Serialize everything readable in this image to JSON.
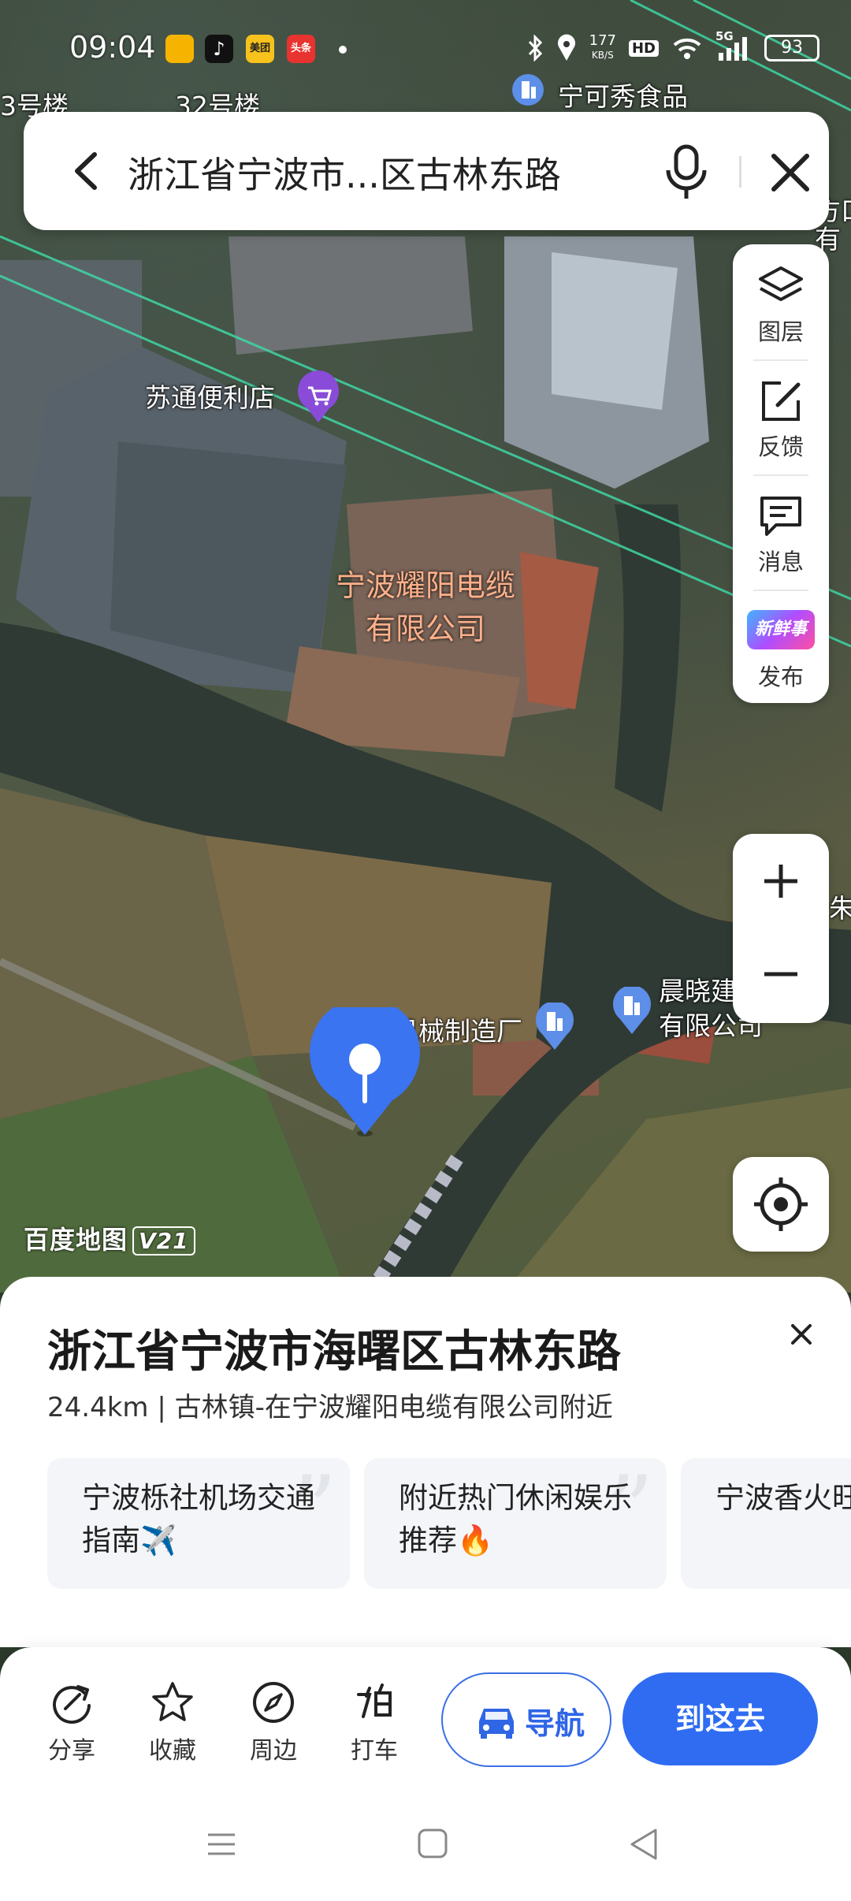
{
  "status_bar": {
    "time": "09:04",
    "net_speed_value": "177",
    "net_speed_unit": "KB/S",
    "hd_label": "HD",
    "network_label": "5G",
    "battery": "93",
    "app_icons": [
      {
        "name": "reader-app-icon",
        "text": "",
        "color": "#f6b400"
      },
      {
        "name": "douyin-app-icon",
        "text": "♪",
        "color": "#111111"
      },
      {
        "name": "meituan-app-icon",
        "text": "美团",
        "color": "#f7c21b"
      },
      {
        "name": "toutiao-app-icon",
        "text": "头条",
        "color": "#e8332f"
      }
    ]
  },
  "search": {
    "query": "浙江省宁波市...区古林东路"
  },
  "map": {
    "labels": {
      "top_store": "宁可秀食品",
      "building_left": "3号楼",
      "building_32": "32号楼",
      "convenience": "苏通便利店",
      "company": "宁波耀阳电缆有限公司",
      "company_line1": "宁波耀阳电缆",
      "company_line2": "有限公司",
      "factory": "机械制造厂",
      "factory_prefix": "佳",
      "chenxiao_line1": "晨晓建",
      "chenxiao_line2": "有限公司",
      "edge_right": "朱",
      "top_right_line1": "方口",
      "top_right_line2": "有"
    },
    "logo_text": "百度地图",
    "logo_version": "V21",
    "colors": {
      "accent_blue": "#2f6cf2",
      "pin_blue": "#3b74f0",
      "road_green": "#3fd6a4",
      "poi_purple": "#8a4bd9",
      "poi_blue": "#5d8ee8"
    }
  },
  "tools": {
    "layers": "图层",
    "feedback": "反馈",
    "messages": "消息",
    "publish": "发布",
    "publish_badge": "新鲜事"
  },
  "place": {
    "title": "浙江省宁波市海曙区古林东路",
    "subtitle": "24.4km | 古林镇-在宁波耀阳电缆有限公司附近",
    "recommendations": [
      {
        "text": "宁波栎社机场交通指南✈️"
      },
      {
        "text": "附近热门休闲娱乐推荐🔥"
      },
      {
        "text": "宁波香火旺地方🕯️"
      }
    ]
  },
  "actions": {
    "share": "分享",
    "favorite": "收藏",
    "nearby": "周边",
    "taxi": "打车",
    "navigate": "导航",
    "go_here": "到这去"
  }
}
